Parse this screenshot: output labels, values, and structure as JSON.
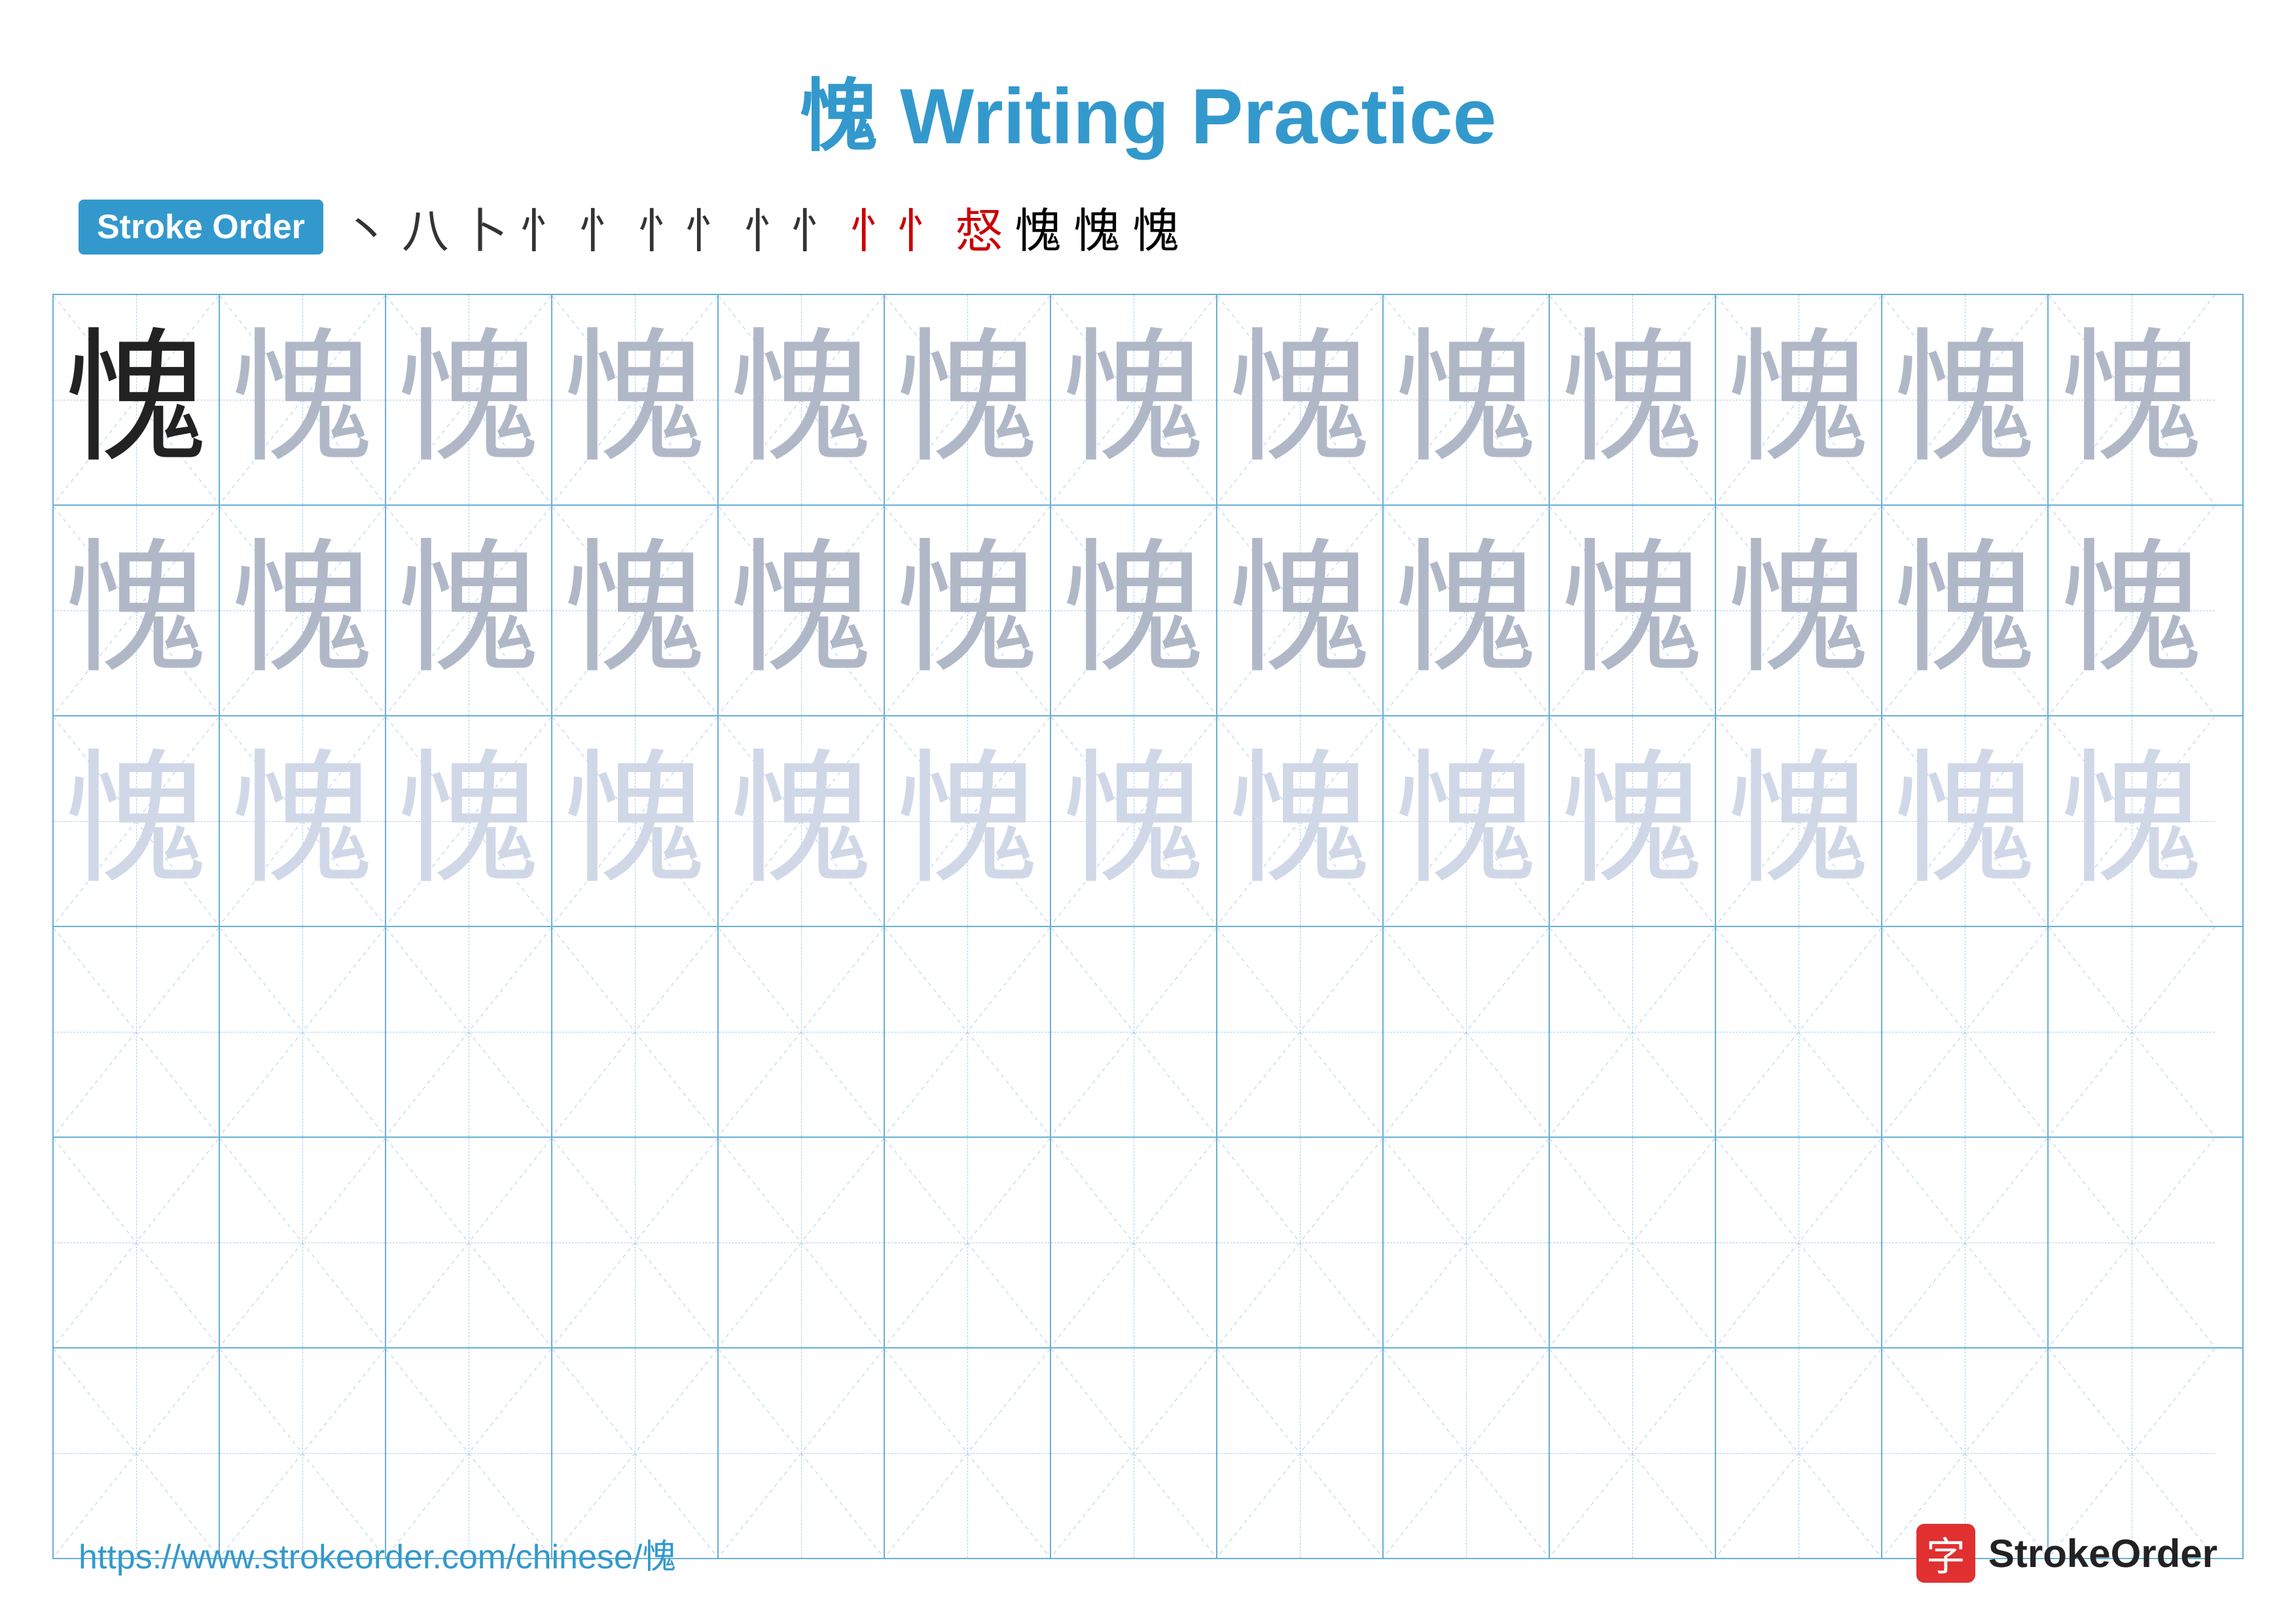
{
  "title": {
    "char": "愧",
    "text": " Writing Practice"
  },
  "stroke_order": {
    "badge_label": "Stroke Order",
    "strokes": [
      "丶",
      "八",
      "卜",
      "忄",
      "忄",
      "忄忄",
      "忄忄",
      "忄忄",
      "惄",
      "愧",
      "愧",
      "愧"
    ]
  },
  "grid": {
    "char": "愧",
    "cols": 13,
    "rows": [
      {
        "type": "filled",
        "intensities": [
          "dark",
          "medium",
          "medium",
          "medium",
          "medium",
          "medium",
          "medium",
          "medium",
          "medium",
          "medium",
          "medium",
          "medium",
          "medium"
        ]
      },
      {
        "type": "filled",
        "intensities": [
          "medium",
          "medium",
          "medium",
          "medium",
          "medium",
          "medium",
          "medium",
          "medium",
          "medium",
          "medium",
          "medium",
          "medium",
          "medium"
        ]
      },
      {
        "type": "filled",
        "intensities": [
          "light",
          "light",
          "light",
          "light",
          "light",
          "light",
          "light",
          "light",
          "light",
          "light",
          "light",
          "light",
          "light"
        ]
      },
      {
        "type": "empty"
      },
      {
        "type": "empty"
      },
      {
        "type": "empty"
      }
    ]
  },
  "footer": {
    "url": "https://www.strokeorder.com/chinese/愧",
    "logo_char": "字",
    "logo_text": "StrokeOrder"
  }
}
